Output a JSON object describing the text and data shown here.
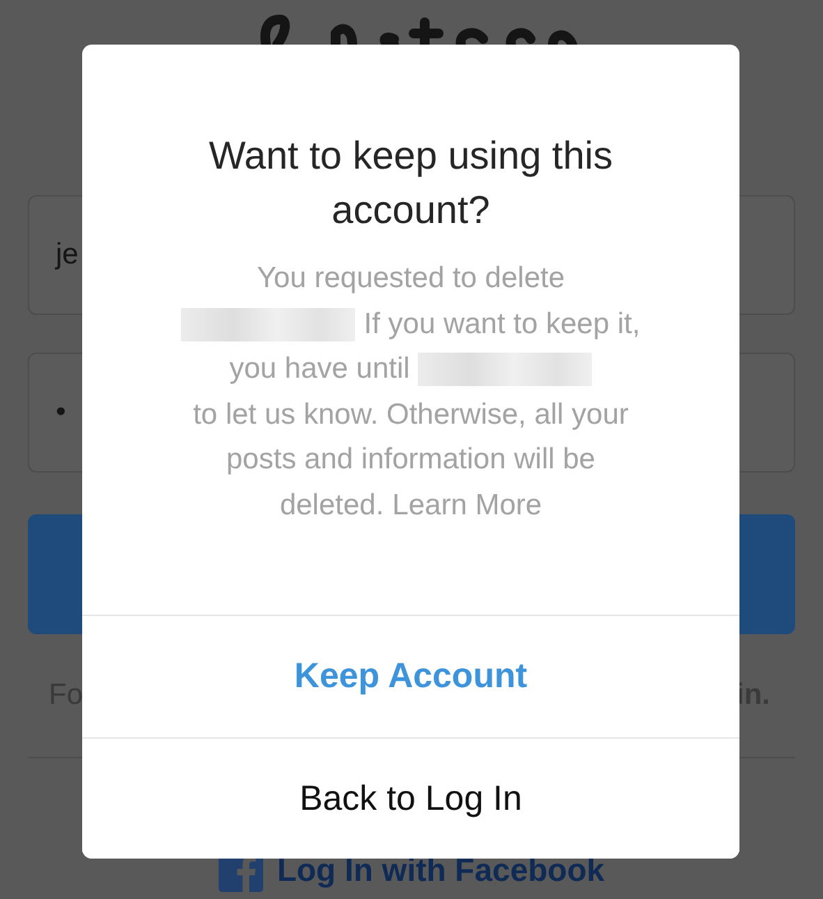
{
  "login": {
    "username": {
      "value": "je"
    },
    "password": {
      "value": "•"
    },
    "help_left": "Fo",
    "help_right": "in.",
    "facebook": "Log In with Facebook"
  },
  "dialog": {
    "title": "Want to keep using this account?",
    "message_lines": [
      [
        {
          "kind": "text",
          "text": "You requested to delete"
        }
      ],
      [
        {
          "kind": "redacted"
        },
        {
          "kind": "text",
          "text": "If you want to keep it,"
        }
      ],
      [
        {
          "kind": "text",
          "text": "you have until"
        },
        {
          "kind": "redacted"
        }
      ],
      [
        {
          "kind": "text",
          "text": "to let us know. Otherwise, all your"
        }
      ],
      [
        {
          "kind": "text",
          "text": "posts and information will be"
        }
      ],
      [
        {
          "kind": "text",
          "text": "deleted."
        },
        {
          "kind": "link",
          "text": "Learn More"
        }
      ]
    ],
    "actions": [
      {
        "label": "Keep Account",
        "primary": true
      },
      {
        "label": "Back to Log In",
        "primary": false
      }
    ]
  }
}
